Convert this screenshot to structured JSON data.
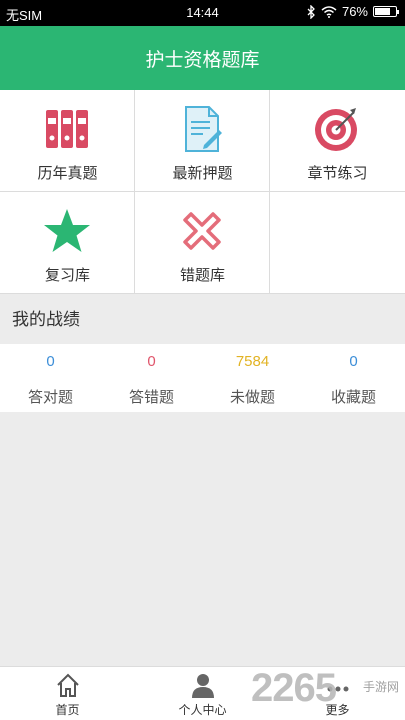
{
  "status_bar": {
    "carrier": "无SIM",
    "time": "14:44",
    "battery": "76%",
    "battery_level": 0.76
  },
  "header": {
    "title": "护士资格题库"
  },
  "grid": {
    "items": [
      {
        "label": "历年真题",
        "icon": "binders-icon"
      },
      {
        "label": "最新押题",
        "icon": "document-edit-icon"
      },
      {
        "label": "章节练习",
        "icon": "target-icon"
      },
      {
        "label": "复习库",
        "icon": "star-icon"
      },
      {
        "label": "错题库",
        "icon": "cross-icon"
      }
    ]
  },
  "section": {
    "title": "我的战绩"
  },
  "stats": [
    {
      "value": "0",
      "label": "答对题",
      "color": "#3c8ed8"
    },
    {
      "value": "0",
      "label": "答错题",
      "color": "#e0556b"
    },
    {
      "value": "7584",
      "label": "未做题",
      "color": "#e2b324"
    },
    {
      "value": "0",
      "label": "收藏题",
      "color": "#3c8ed8"
    }
  ],
  "bottom_nav": [
    {
      "label": "首页",
      "icon": "home-icon"
    },
    {
      "label": "个人中心",
      "icon": "person-icon"
    },
    {
      "label": "更多",
      "icon": "more-icon"
    }
  ],
  "watermark": {
    "number": "2265",
    "text": "手游网"
  },
  "colors": {
    "brand": "#2bb673",
    "red": "#e0556b",
    "teal": "#2bb673"
  }
}
